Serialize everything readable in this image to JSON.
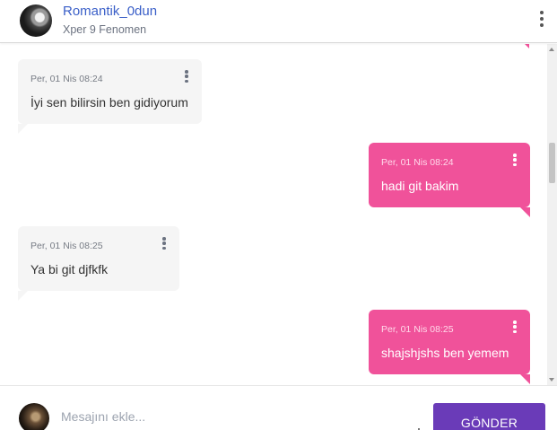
{
  "header": {
    "username": "Romantik_0dun",
    "subtitle": "Xper 9 Fenomen",
    "menu_icon": "more-vertical-icon"
  },
  "messages": [
    {
      "direction": "incoming",
      "time": "Per, 01 Nis 08:24",
      "text": "İyi sen bilirsin ben gidiyorum"
    },
    {
      "direction": "outgoing",
      "time": "Per, 01 Nis 08:24",
      "text": "hadi git bakim"
    },
    {
      "direction": "incoming",
      "time": "Per, 01 Nis 08:25",
      "text": "Ya bi git djfkfk"
    },
    {
      "direction": "outgoing",
      "time": "Per, 01 Nis 08:25",
      "text": "shajshjshs ben yemem"
    }
  ],
  "composer": {
    "placeholder": "Mesajını ekle...",
    "send_label": "GÖNDER"
  },
  "colors": {
    "outgoing_bubble": "#f0529a",
    "incoming_bubble": "#f5f5f5",
    "send_button": "#6a3bb8",
    "username": "#3a5fc8"
  }
}
